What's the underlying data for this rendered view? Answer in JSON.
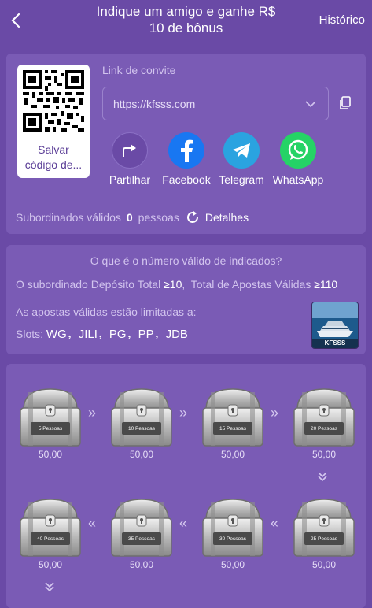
{
  "header": {
    "title_line1": "Indique um amigo e ganhe R$",
    "title_line2": "10 de bônus",
    "history_label": "Histórico"
  },
  "invite": {
    "qr_caption_line1": "Salvar",
    "qr_caption_line2": "código de...",
    "link_label": "Link de convite",
    "link_value": "https://kfsss.com"
  },
  "share": [
    {
      "label": "Partilhar",
      "icon": "share-icon",
      "color": "#6a4aa6"
    },
    {
      "label": "Facebook",
      "icon": "facebook-icon",
      "color": "#1877f2"
    },
    {
      "label": "Telegram",
      "icon": "telegram-icon",
      "color": "#2aa3e0"
    },
    {
      "label": "WhatsApp",
      "icon": "whatsapp-icon",
      "color": "#25d366"
    }
  ],
  "subordinates": {
    "label": "Subordinados válidos",
    "count": "0",
    "unit": "pessoas",
    "details_label": "Detalhes"
  },
  "rules": {
    "question": "O que é o número válido de indicados?",
    "condition_prefix": "O subordinado Depósito Total",
    "condition_deposit": "≥10",
    "condition_mid": "Total de Apostas Válidas",
    "condition_bets": "≥110",
    "limit_text": "As apostas válidas estão limitadas a:",
    "slots_label": "Slots:",
    "slots_value": "WG，JILI，PG，PP，JDB",
    "game_thumb_text": "KFSSS"
  },
  "rewards": {
    "row1": [
      {
        "label": "5 Pessoas",
        "amount": "50,00"
      },
      {
        "label": "10 Pessoas",
        "amount": "50,00"
      },
      {
        "label": "15 Pessoas",
        "amount": "50,00"
      },
      {
        "label": "20 Pessoas",
        "amount": "50,00"
      }
    ],
    "row2": [
      {
        "label": "40 Pessoas",
        "amount": "50,00"
      },
      {
        "label": "35 Pessoas",
        "amount": "50,00"
      },
      {
        "label": "30 Pessoas",
        "amount": "50,00"
      },
      {
        "label": "25 Pessoas",
        "amount": "50,00"
      }
    ]
  }
}
